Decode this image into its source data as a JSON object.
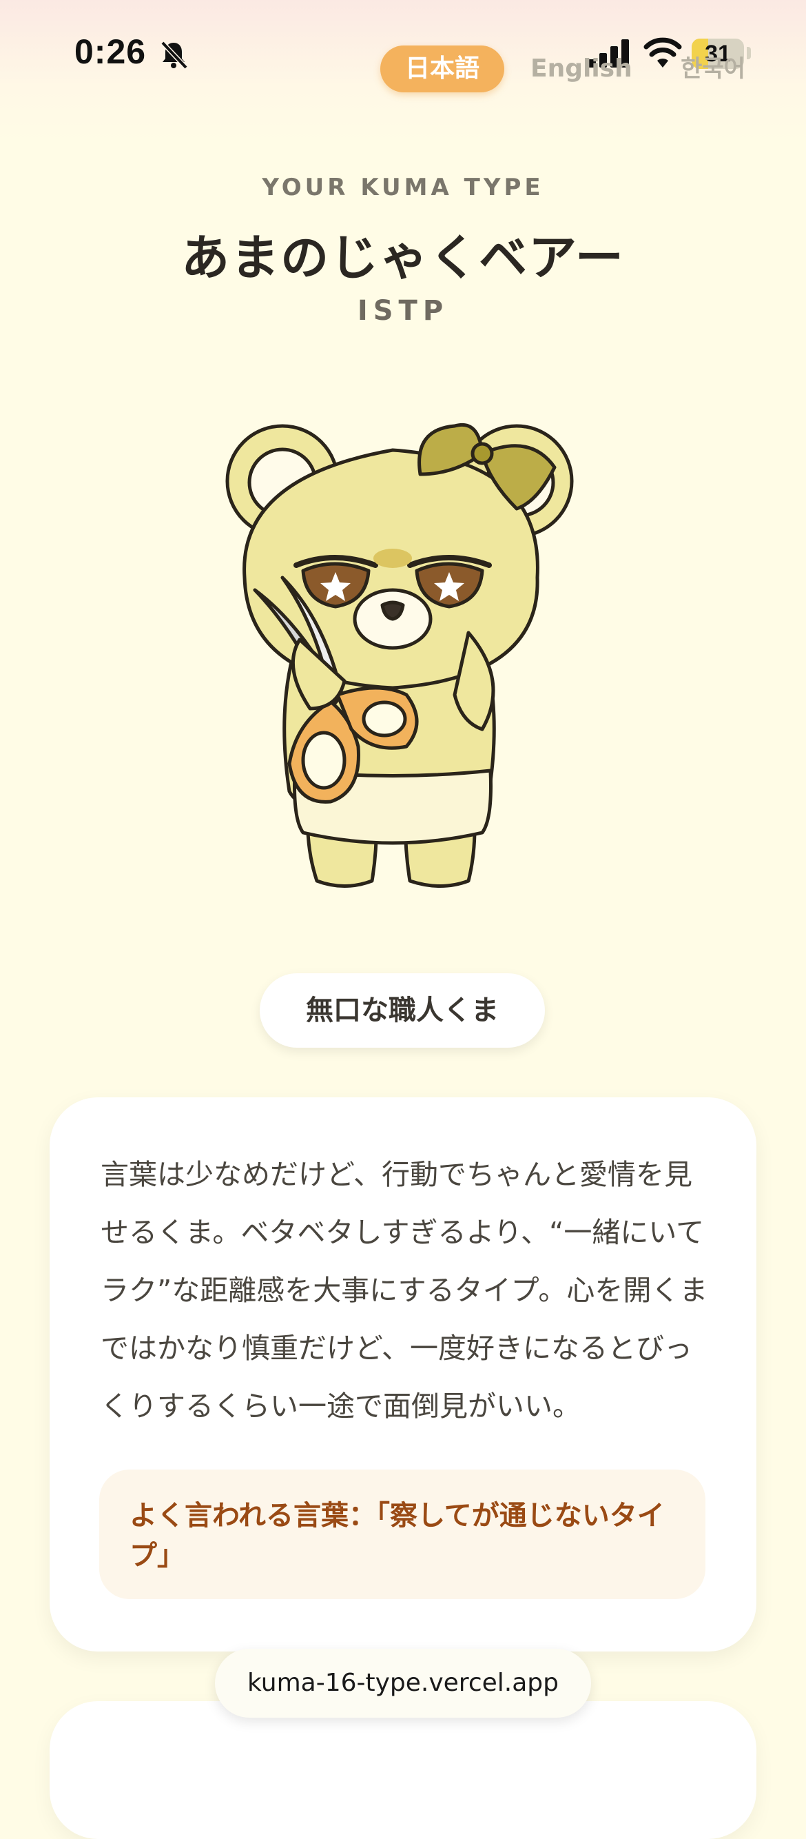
{
  "status_bar": {
    "time": "0:26",
    "battery_level": "31",
    "icons": [
      "bell-slash-icon",
      "cellular-signal-icon",
      "wifi-icon",
      "battery-icon"
    ]
  },
  "language_switch": {
    "options": [
      {
        "label": "日本語",
        "selected": true
      },
      {
        "label": "English",
        "selected": false
      },
      {
        "label": "한국어",
        "selected": false
      }
    ]
  },
  "result": {
    "eyebrow": "YOUR KUMA TYPE",
    "type_name": "あまのじゃくベアー",
    "mbti": "ISTP",
    "illustration": "bear-with-scissors",
    "nickname": "無口な職人くま",
    "description": "言葉は少なめだけど、行動でちゃんと愛情を見せるくま。ベタベタしすぎるより、“一緒にいてラク”な距離感を大事にするタイプ。心を開くまではかなり慎重だけど、一度好きになるとびっくりするくらい一途で面倒見がいい。",
    "quote": "よく言われる言葉：「察してが通じないタイプ」"
  },
  "browser": {
    "url": "kuma-16-type.vercel.app"
  },
  "colors": {
    "background": "#fffce6",
    "accent": "#f4b25d",
    "quote_text": "#9a4a14",
    "quote_bg": "#fdf6ea"
  }
}
